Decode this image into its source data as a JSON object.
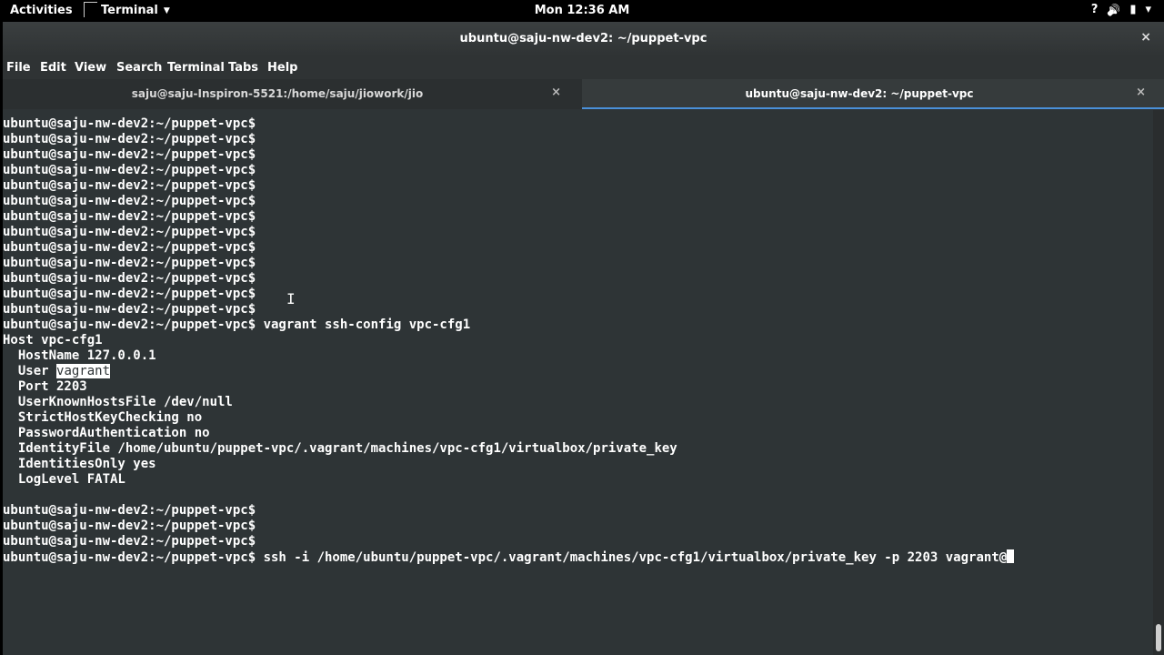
{
  "topbar": {
    "activities": "Activities",
    "app_menu": "Terminal",
    "clock": "Mon 12:36 AM",
    "icons": [
      "help-icon",
      "volume-icon",
      "battery-icon",
      "chevron-down-icon"
    ],
    "tray_glyphs": [
      "?",
      "🔊",
      "▮",
      "▾"
    ]
  },
  "window": {
    "title": "ubuntu@saju-nw-dev2: ~/puppet-vpc",
    "close": "×"
  },
  "menu": [
    "File",
    "Edit",
    "View",
    "Search",
    "Terminal",
    "Tabs",
    "Help"
  ],
  "tabs": [
    {
      "label": "saju@saju-Inspiron-5521:/home/saju/jiowork/jio",
      "close": "×",
      "active": false
    },
    {
      "label": "ubuntu@saju-nw-dev2: ~/puppet-vpc",
      "close": "×",
      "active": true
    }
  ],
  "terminal": {
    "lines": [
      "ubuntu@saju-nw-dev2:~/puppet-vpc$",
      "ubuntu@saju-nw-dev2:~/puppet-vpc$",
      "ubuntu@saju-nw-dev2:~/puppet-vpc$",
      "ubuntu@saju-nw-dev2:~/puppet-vpc$",
      "ubuntu@saju-nw-dev2:~/puppet-vpc$",
      "ubuntu@saju-nw-dev2:~/puppet-vpc$",
      "ubuntu@saju-nw-dev2:~/puppet-vpc$",
      "ubuntu@saju-nw-dev2:~/puppet-vpc$",
      "ubuntu@saju-nw-dev2:~/puppet-vpc$",
      "ubuntu@saju-nw-dev2:~/puppet-vpc$",
      "ubuntu@saju-nw-dev2:~/puppet-vpc$",
      "ubuntu@saju-nw-dev2:~/puppet-vpc$",
      "ubuntu@saju-nw-dev2:~/puppet-vpc$",
      "ubuntu@saju-nw-dev2:~/puppet-vpc$ vagrant ssh-config vpc-cfg1",
      "Host vpc-cfg1",
      "  HostName 127.0.0.1",
      "  User ",
      "  Port 2203",
      "  UserKnownHostsFile /dev/null",
      "  StrictHostKeyChecking no",
      "  PasswordAuthentication no",
      "  IdentityFile /home/ubuntu/puppet-vpc/.vagrant/machines/vpc-cfg1/virtualbox/private_key",
      "  IdentitiesOnly yes",
      "  LogLevel FATAL",
      "",
      "ubuntu@saju-nw-dev2:~/puppet-vpc$",
      "ubuntu@saju-nw-dev2:~/puppet-vpc$",
      "ubuntu@saju-nw-dev2:~/puppet-vpc$",
      "ubuntu@saju-nw-dev2:~/puppet-vpc$ ssh -i /home/ubuntu/puppet-vpc/.vagrant/machines/vpc-cfg1/virtualbox/private_key -p 2203 vagrant@"
    ],
    "selected_text": "vagrant",
    "selected_line": 16,
    "cursor_line": 28,
    "ibeam": "I"
  },
  "colors": {
    "terminal_bg": "#2e3436",
    "text": "#ffffff",
    "active_tab_underline": "#4a90d9"
  }
}
